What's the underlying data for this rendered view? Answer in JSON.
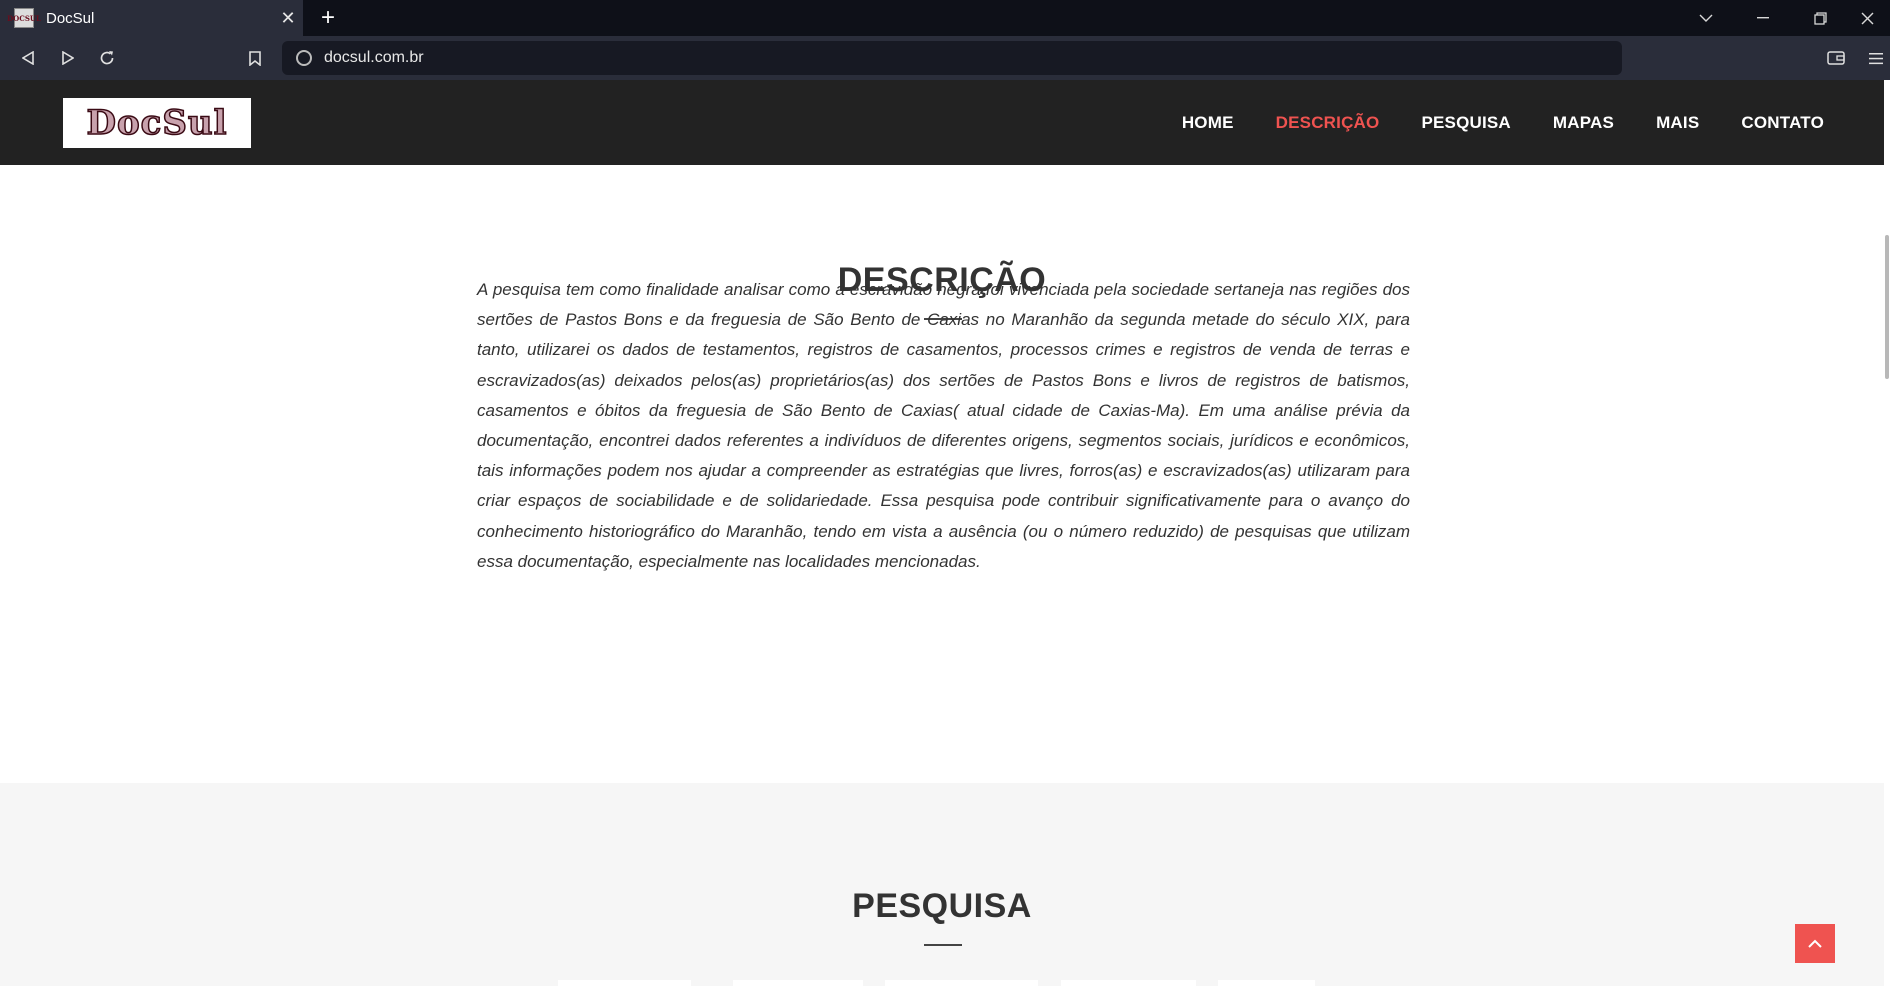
{
  "browser": {
    "tab_title": "DocSul",
    "tab_favicon_text": "DOCSUL",
    "url": "docsul.com.br"
  },
  "site": {
    "logo_text": "DocSul",
    "nav": [
      {
        "label": "HOME"
      },
      {
        "label": "DESCRIÇÃO",
        "active": true
      },
      {
        "label": "PESQUISA"
      },
      {
        "label": "MAPAS"
      },
      {
        "label": "MAIS"
      },
      {
        "label": "CONTATO"
      }
    ],
    "accent_color": "#ef5350"
  },
  "descricao": {
    "title": "DESCRIÇÃO",
    "body": "A pesquisa tem como finalidade analisar como a escravidão negra foi vivenciada pela sociedade sertaneja nas regiões dos sertões de Pastos Bons e da freguesia de São Bento de Caxias no Maranhão da segunda metade do século XIX, para tanto, utilizarei os dados de testamentos, registros de casamentos, processos crimes e registros de venda de terras e escravizados(as) deixados pelos(as) proprietários(as) dos sertões de Pastos Bons e livros de registros de batismos, casamentos e óbitos da freguesia de São Bento de Caxias( atual cidade de Caxias-Ma). Em uma análise prévia da documentação, encontrei dados referentes a indivíduos de diferentes origens, segmentos sociais, jurídicos e econômicos, tais informações podem nos ajudar a compreender as estratégias que livres, forros(as) e escravizados(as) utilizaram para criar espaços de sociabilidade e de solidariedade. Essa pesquisa pode contribuir significativamente para o avanço do conhecimento historiográfico do Maranhão, tendo em vista a ausência (ou o número reduzido) de pesquisas que utilizam essa documentação, especialmente nas localidades mencionadas."
  },
  "pesquisa": {
    "title": "PESQUISA"
  },
  "icons": {
    "back_to_top": "chevron-up-icon"
  }
}
